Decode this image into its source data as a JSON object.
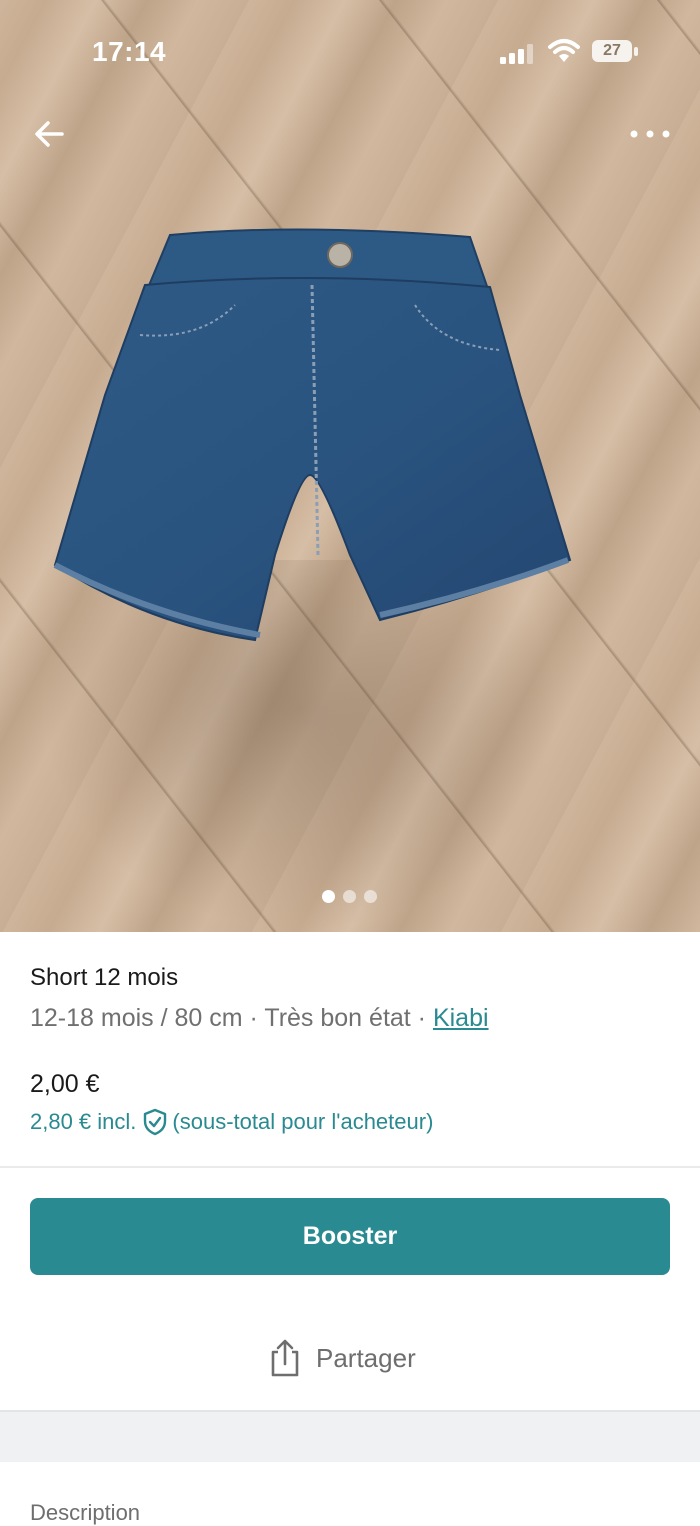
{
  "status": {
    "time": "17:14",
    "battery": "27"
  },
  "gallery": {
    "image_label": "Photo of denim baby shorts on wooden floor",
    "page_count": 3,
    "active_page": 1
  },
  "item": {
    "title": "Short 12 mois",
    "size": "12-18 mois / 80 cm",
    "separator": " · ",
    "condition": "Très bon état",
    "brand": "Kiabi",
    "price": "2,00 €",
    "buyer_price": "2,80 € incl.",
    "buyer_note": "(sous-total pour l'acheteur)"
  },
  "actions": {
    "booster_label": "Booster",
    "share_label": "Partager"
  },
  "section": {
    "description_label": "Description"
  },
  "colors": {
    "accent": "#2a8a91",
    "text_muted": "#707070"
  }
}
